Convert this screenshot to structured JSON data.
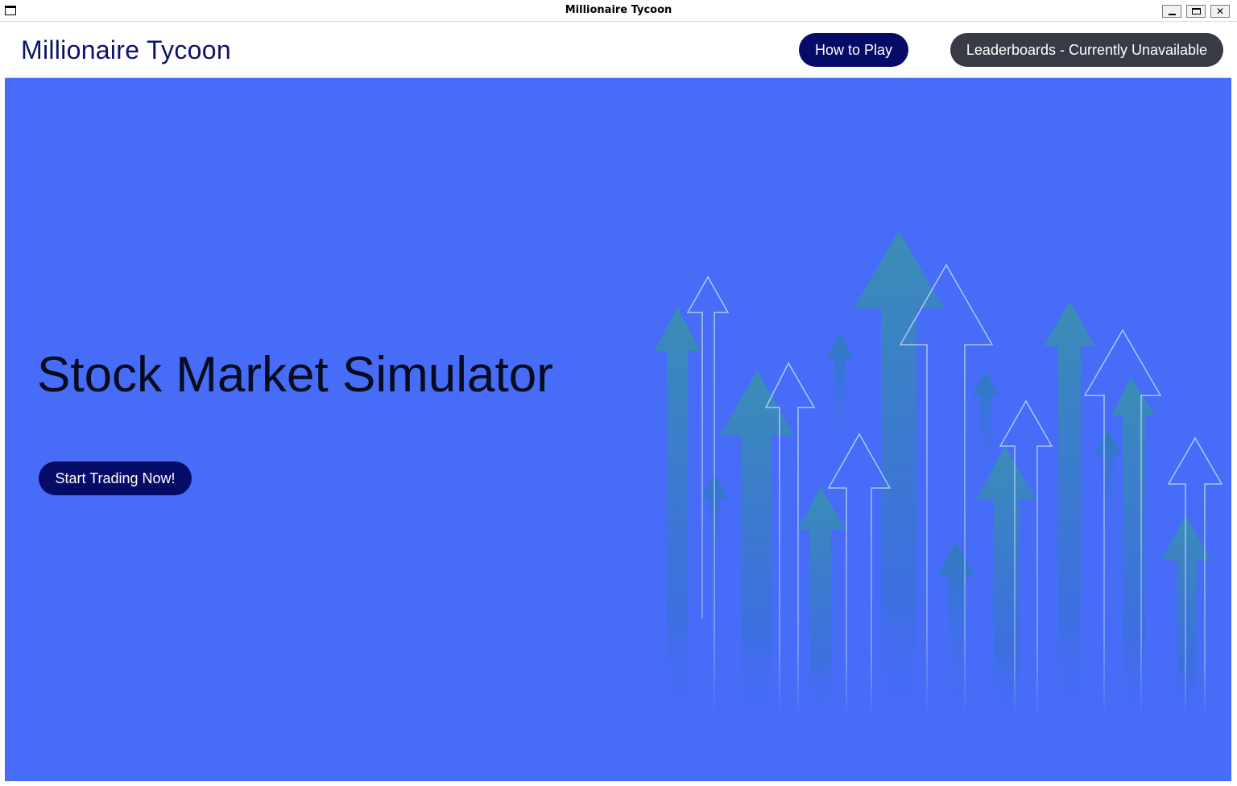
{
  "window": {
    "title": "Millionaire Tycoon",
    "controls": [
      "minimize",
      "maximize",
      "close"
    ]
  },
  "navbar": {
    "brand": "Millionaire Tycoon",
    "how_to_play_label": "How to Play",
    "leaderboards_label": "Leaderboards - Currently Unavailable"
  },
  "hero": {
    "title": "Stock Market Simulator",
    "cta_label": "Start Trading Now!",
    "illustration": "rising-arrows-illustration"
  },
  "colors": {
    "background": "#466cf8",
    "navbar": "#ffffff",
    "brand_text": "#0c136a",
    "primary_button": "#070b68",
    "disabled_button": "#383a45",
    "arrow_fill": "#3a87b8",
    "arrow_outline": "#a9c4f6"
  },
  "icons": {
    "window_icon": "window-icon",
    "minimize": "minimize-icon",
    "maximize": "maximize-icon",
    "close": "close-icon"
  }
}
